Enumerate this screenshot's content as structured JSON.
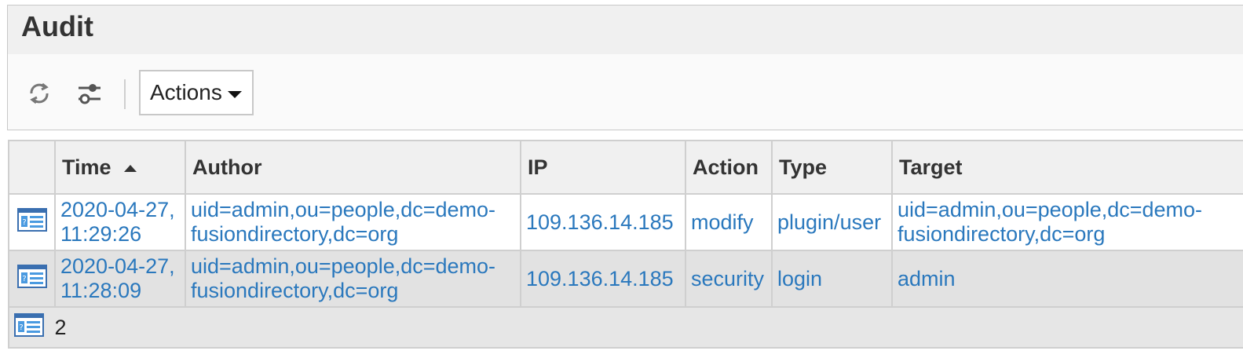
{
  "panel": {
    "title": "Audit",
    "toolbar": {
      "refresh_icon": "refresh-icon",
      "filter_icon": "filter-sliders-icon",
      "actions_label": "Actions"
    }
  },
  "table": {
    "columns": {
      "icon": "",
      "time": "Time",
      "author": "Author",
      "ip": "IP",
      "action": "Action",
      "type": "Type",
      "target": "Target"
    },
    "sort": {
      "column": "time",
      "direction": "ascending"
    },
    "rows": [
      {
        "icon": "audit-entry-icon",
        "time_date": "2020-04-27,",
        "time_clock": "11:29:26",
        "author_line1": "uid=admin,ou=people,dc=demo-",
        "author_line2": "fusiondirectory,dc=org",
        "ip": "109.136.14.185",
        "action": "modify",
        "type": "plugin/user",
        "target_line1": "uid=admin,ou=people,dc=demo-",
        "target_line2": "fusiondirectory,dc=org"
      },
      {
        "icon": "audit-entry-icon",
        "time_date": "2020-04-27,",
        "time_clock": "11:28:09",
        "author_line1": "uid=admin,ou=people,dc=demo-",
        "author_line2": "fusiondirectory,dc=org",
        "ip": "109.136.14.185",
        "action": "security",
        "type": "login",
        "target_line1": "admin",
        "target_line2": ""
      }
    ],
    "footer": {
      "icon": "audit-entry-icon",
      "count": "2"
    }
  },
  "colors": {
    "link": "#2a78bd",
    "header_bg": "#f0f0f0",
    "row_alt_bg": "#e2e2e2",
    "border": "#cfcfcf"
  }
}
